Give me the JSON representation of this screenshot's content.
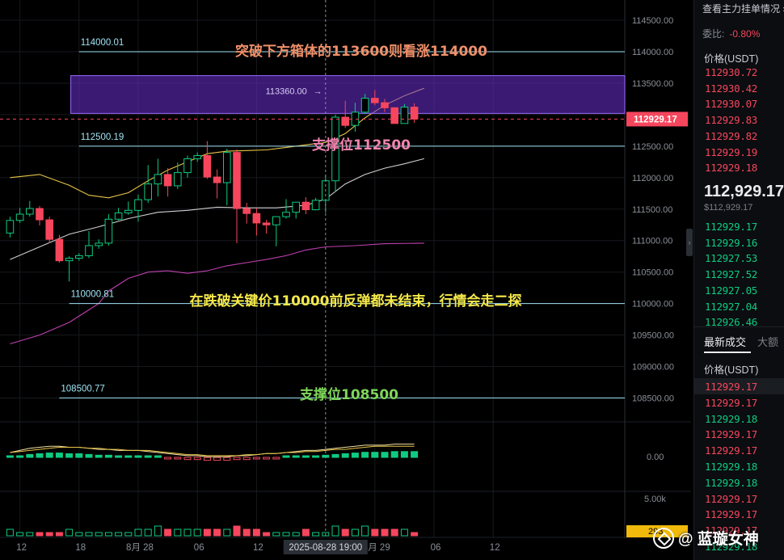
{
  "chart_data": {
    "type": "candlestick",
    "y_ticks": [
      "114500.00",
      "114000.00",
      "113500.00",
      "113000.00",
      "112500.00",
      "112000.00",
      "111500.00",
      "111000.00",
      "110500.00",
      "110000.00",
      "109500.00",
      "109000.00",
      "108500.00"
    ],
    "ylim": [
      108000,
      114700
    ],
    "x_ticks": [
      {
        "label": "12",
        "slot": 1
      },
      {
        "label": "18",
        "slot": 7
      },
      {
        "label": "8月 28",
        "slot": 13
      },
      {
        "label": "06",
        "slot": 19
      },
      {
        "label": "12",
        "slot": 25
      },
      {
        "label": "8月 29",
        "slot": 37
      },
      {
        "label": "06",
        "slot": 43
      },
      {
        "label": "12",
        "slot": 49
      }
    ],
    "crosshair": {
      "slot": 32,
      "label": "2025-08-28 19:00"
    },
    "current_price": {
      "value": 112929.17,
      "label": "112929.17"
    },
    "candles": [
      [
        111120,
        111380,
        111050,
        111320
      ],
      [
        111320,
        111520,
        111280,
        111420
      ],
      [
        111420,
        111630,
        111380,
        111510
      ],
      [
        111510,
        111550,
        111240,
        111330
      ],
      [
        111330,
        111380,
        110960,
        111020
      ],
      [
        111020,
        111090,
        110650,
        110680
      ],
      [
        110680,
        110750,
        110350,
        110720
      ],
      [
        110720,
        110800,
        110680,
        110760
      ],
      [
        110760,
        111150,
        110720,
        110920
      ],
      [
        110920,
        111020,
        110870,
        110960
      ],
      [
        110960,
        111420,
        110920,
        111340
      ],
      [
        111340,
        111520,
        111320,
        111440
      ],
      [
        111440,
        111620,
        111410,
        111480
      ],
      [
        111480,
        111730,
        111300,
        111650
      ],
      [
        111650,
        112200,
        111600,
        111900
      ],
      [
        111900,
        112300,
        111700,
        112050
      ],
      [
        112050,
        112150,
        111700,
        111870
      ],
      [
        111870,
        112240,
        111820,
        112080
      ],
      [
        112080,
        112350,
        112000,
        112300
      ],
      [
        112300,
        112400,
        112250,
        112350
      ],
      [
        112350,
        112580,
        111980,
        112010
      ],
      [
        112010,
        112130,
        111670,
        111920
      ],
      [
        111920,
        112460,
        111560,
        112400
      ],
      [
        112400,
        112450,
        110960,
        111510
      ],
      [
        111510,
        111600,
        111270,
        111430
      ],
      [
        111430,
        111520,
        111080,
        111280
      ],
      [
        111280,
        111330,
        111110,
        111250
      ],
      [
        111250,
        111300,
        110910,
        111380
      ],
      [
        111380,
        111660,
        111350,
        111450
      ],
      [
        111450,
        111560,
        111350,
        111610
      ],
      [
        111610,
        111690,
        111420,
        111490
      ],
      [
        111490,
        111680,
        111480,
        111640
      ],
      [
        111640,
        112040,
        111440,
        111950
      ],
      [
        111950,
        113000,
        111780,
        112960
      ],
      [
        112960,
        113220,
        112790,
        112830
      ],
      [
        112830,
        113190,
        112730,
        113040
      ],
      [
        113040,
        113330,
        113010,
        113260
      ],
      [
        113260,
        113390,
        113150,
        113190
      ],
      [
        113190,
        113250,
        113040,
        113110
      ],
      [
        113110,
        113120,
        112860,
        112860
      ],
      [
        112860,
        113170,
        112860,
        113120
      ],
      [
        113120,
        113180,
        112870,
        112930
      ]
    ],
    "overlays": [
      {
        "name": "ma_short",
        "color": "#e8c547",
        "points": [
          [
            0,
            112000
          ],
          [
            3,
            112050
          ],
          [
            6,
            111880
          ],
          [
            8,
            111720
          ],
          [
            10,
            111680
          ],
          [
            12,
            111760
          ],
          [
            14,
            111950
          ],
          [
            16,
            112120
          ],
          [
            18,
            112250
          ],
          [
            20,
            112380
          ],
          [
            22,
            112420
          ],
          [
            24,
            112430
          ],
          [
            26,
            112440
          ],
          [
            28,
            112480
          ],
          [
            30,
            112520
          ],
          [
            32,
            112560
          ],
          [
            34,
            112700
          ],
          [
            36,
            112950
          ],
          [
            38,
            113150
          ],
          [
            40,
            113300
          ],
          [
            42,
            113420
          ]
        ]
      },
      {
        "name": "ma_mid",
        "color": "#cfcfcf",
        "points": [
          [
            0,
            110700
          ],
          [
            3,
            110900
          ],
          [
            6,
            111100
          ],
          [
            9,
            111220
          ],
          [
            12,
            111350
          ],
          [
            15,
            111450
          ],
          [
            18,
            111480
          ],
          [
            21,
            111530
          ],
          [
            24,
            111520
          ],
          [
            27,
            111520
          ],
          [
            30,
            111560
          ],
          [
            32,
            111660
          ],
          [
            34,
            111900
          ],
          [
            36,
            112050
          ],
          [
            38,
            112150
          ],
          [
            40,
            112220
          ],
          [
            42,
            112300
          ]
        ]
      },
      {
        "name": "ma_long",
        "color": "#c040b0",
        "points": [
          [
            0,
            109360
          ],
          [
            3,
            109500
          ],
          [
            6,
            109700
          ],
          [
            8,
            109900
          ],
          [
            9,
            110000
          ],
          [
            10,
            110200
          ],
          [
            12,
            110400
          ],
          [
            14,
            110500
          ],
          [
            16,
            110520
          ],
          [
            18,
            110480
          ],
          [
            20,
            110520
          ],
          [
            22,
            110600
          ],
          [
            24,
            110650
          ],
          [
            26,
            110700
          ],
          [
            28,
            110760
          ],
          [
            30,
            110850
          ],
          [
            32,
            110900
          ],
          [
            35,
            110920
          ],
          [
            38,
            110950
          ],
          [
            42,
            110960
          ]
        ]
      }
    ],
    "levels": [
      {
        "value": 114000,
        "label": "114000.01",
        "slot_start": 7,
        "color": "#9fe3f3"
      },
      {
        "value": 112500,
        "label": "112500.19",
        "slot_start": 7,
        "color": "#9fe3f3"
      },
      {
        "value": 110000,
        "label": "110000.81",
        "slot_start": 6,
        "color": "#9fe3f3"
      },
      {
        "value": 108500,
        "label": "108500.77",
        "slot_start": 5,
        "color": "#9fe3f3"
      }
    ],
    "box": {
      "slot_start": 6,
      "y_high": 113620,
      "y_low": 113020,
      "color": "#6a2fd1",
      "label": "113360.00"
    },
    "annotations": [
      {
        "text": "突破下方箱体的113600则看涨114000",
        "anchor_value": 114000,
        "color": "#f0906a"
      },
      {
        "text": "支撑位112500",
        "anchor_value": 112500,
        "color": "#f085b0"
      },
      {
        "text": "在跌破关键价110000前反弹都未结束，行情会走二探",
        "anchor_value": 110000,
        "color": "#f5e94a"
      },
      {
        "text": "支撑位108500",
        "anchor_value": 108500,
        "color": "#7fd65a"
      }
    ],
    "oscillator": {
      "axis_labels": [
        "0.00"
      ],
      "line_a": [
        0,
        2,
        4,
        5,
        6,
        6,
        5,
        5,
        4,
        3,
        3,
        2,
        2,
        2,
        1,
        0,
        -1,
        -2,
        -3,
        -3,
        -4,
        -4,
        -4,
        -3,
        -3,
        -2,
        -1,
        -1,
        0,
        1,
        2,
        2,
        3,
        4,
        5,
        6,
        7,
        7,
        7,
        8,
        8,
        8
      ],
      "line_b": [
        0,
        1,
        2,
        3,
        4,
        5,
        5,
        5,
        4,
        4,
        3,
        3,
        2,
        2,
        2,
        1,
        0,
        -1,
        -2,
        -2,
        -3,
        -3,
        -3,
        -3,
        -2,
        -2,
        -1,
        -1,
        0,
        0,
        1,
        1,
        2,
        3,
        3,
        4,
        5,
        6,
        6,
        6,
        6,
        6
      ]
    },
    "volume": {
      "axis_label": "5.00k",
      "current_label": "293",
      "values": [
        2,
        1,
        1,
        1,
        1,
        1,
        2,
        1,
        1,
        1,
        1,
        1,
        1,
        2,
        2,
        3,
        2,
        2,
        2,
        2,
        2,
        2,
        2,
        3,
        2,
        2,
        1,
        1,
        1,
        1,
        2,
        1,
        1,
        3,
        2,
        2,
        3,
        2,
        2,
        2,
        2,
        1
      ]
    }
  },
  "order_book": {
    "title": "查看主力挂单情况 ›",
    "ratio_label": "委比:",
    "ratio_value": "-0.80%",
    "price_header": "价格(USDT)",
    "asks": [
      "112930.72",
      "112930.42",
      "112930.07",
      "112929.83",
      "112929.82",
      "112929.19",
      "112929.18"
    ],
    "mid_price": "112,929.17",
    "mid_sub": "$112,929.17",
    "bids": [
      "112929.17",
      "112929.16",
      "112927.53",
      "112927.52",
      "112927.05",
      "112927.04",
      "112926.46"
    ]
  },
  "trades": {
    "tab_active": "最新成交",
    "tab_other": "大额",
    "price_header": "价格(USDT)",
    "rows": [
      {
        "price": "112929.17",
        "side": "sell"
      },
      {
        "price": "112929.17",
        "side": "sell"
      },
      {
        "price": "112929.18",
        "side": "buy"
      },
      {
        "price": "112929.17",
        "side": "sell"
      },
      {
        "price": "112929.17",
        "side": "sell"
      },
      {
        "price": "112929.18",
        "side": "buy"
      },
      {
        "price": "112929.18",
        "side": "buy"
      },
      {
        "price": "112929.17",
        "side": "sell"
      },
      {
        "price": "112929.17",
        "side": "sell"
      },
      {
        "price": "112929.17",
        "side": "sell"
      },
      {
        "price": "112929.18",
        "side": "buy"
      }
    ]
  },
  "watermark": "@ 蓝璇女神",
  "colors": {
    "up": "#0ecb81",
    "down": "#f6465d",
    "grid": "#16191e",
    "text": "#8a8f97"
  }
}
